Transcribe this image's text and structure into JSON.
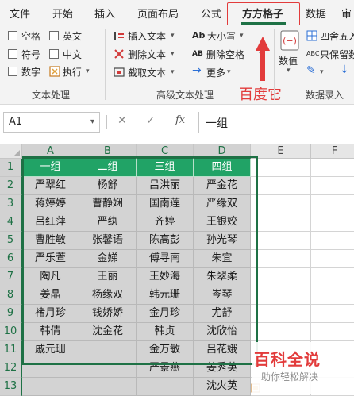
{
  "ribbon_tabs": [
    "文件",
    "开始",
    "插入",
    "页面布局",
    "公式",
    "方方格子",
    "数据",
    "审"
  ],
  "active_tab": "方方格子",
  "text_processing": {
    "checkboxes": [
      "空格",
      "英文",
      "符号",
      "中文",
      "数字"
    ],
    "execute": "执行",
    "group_label": "文本处理"
  },
  "advanced_text": {
    "insert_text": "插入文本",
    "delete_text": "删除文本",
    "extract_text": "截取文本",
    "case": "大小写",
    "delete_spaces": "删除空格",
    "more": "更多",
    "case_icon": "Ab",
    "spaces_icon": "AB",
    "group_label": "高级文本处理"
  },
  "number_input": {
    "value_button": "数值",
    "round": "四舍五入",
    "keep_values": "只保留数",
    "keep_icon": "ABC",
    "group_label": "数据录入"
  },
  "annotation": "百度它",
  "formula_bar": {
    "name_box": "A1",
    "cancel_glyph": "✕",
    "confirm_glyph": "✓",
    "fx": "fx",
    "value": "一组"
  },
  "sheet": {
    "columns": [
      "A",
      "B",
      "C",
      "D",
      "E",
      "F"
    ],
    "rows": [
      "1",
      "2",
      "3",
      "4",
      "5",
      "6",
      "7",
      "8",
      "9",
      "10",
      "11",
      "12",
      "13"
    ],
    "cells": [
      [
        "一组",
        "二组",
        "三组",
        "四组"
      ],
      [
        "严翠红",
        "杨舒",
        "吕洪丽",
        "严金花"
      ],
      [
        "蒋婷婷",
        "曹静娴",
        "国南莲",
        "严缘双"
      ],
      [
        "吕红萍",
        "严纨",
        "齐婷",
        "王银姣"
      ],
      [
        "曹胜敏",
        "张馨语",
        "陈高彭",
        "孙光琴"
      ],
      [
        "严乐萱",
        "金娣",
        "傅寻南",
        "朱宜"
      ],
      [
        "陶凡",
        "王丽",
        "王妙海",
        "朱翠柔"
      ],
      [
        "姜晶",
        "杨缘双",
        "韩元珊",
        "岑琴"
      ],
      [
        "褚月珍",
        "钱娇娇",
        "金月珍",
        "尤舒"
      ],
      [
        "韩倩",
        "沈金花",
        "韩贞",
        "沈欣怡"
      ],
      [
        "戚元珊",
        "",
        "金万敏",
        "吕花娥"
      ],
      [
        "",
        "",
        "严景燕",
        "姜秀英"
      ],
      [
        "",
        "",
        "",
        "沈火英"
      ]
    ]
  },
  "watermark": {
    "logo": "百科全说",
    "sub": "助你轻松解决"
  },
  "colors": {
    "accent_green": "#1e7145",
    "header_green": "#21a366",
    "annotation_red": "#e23b3b"
  }
}
